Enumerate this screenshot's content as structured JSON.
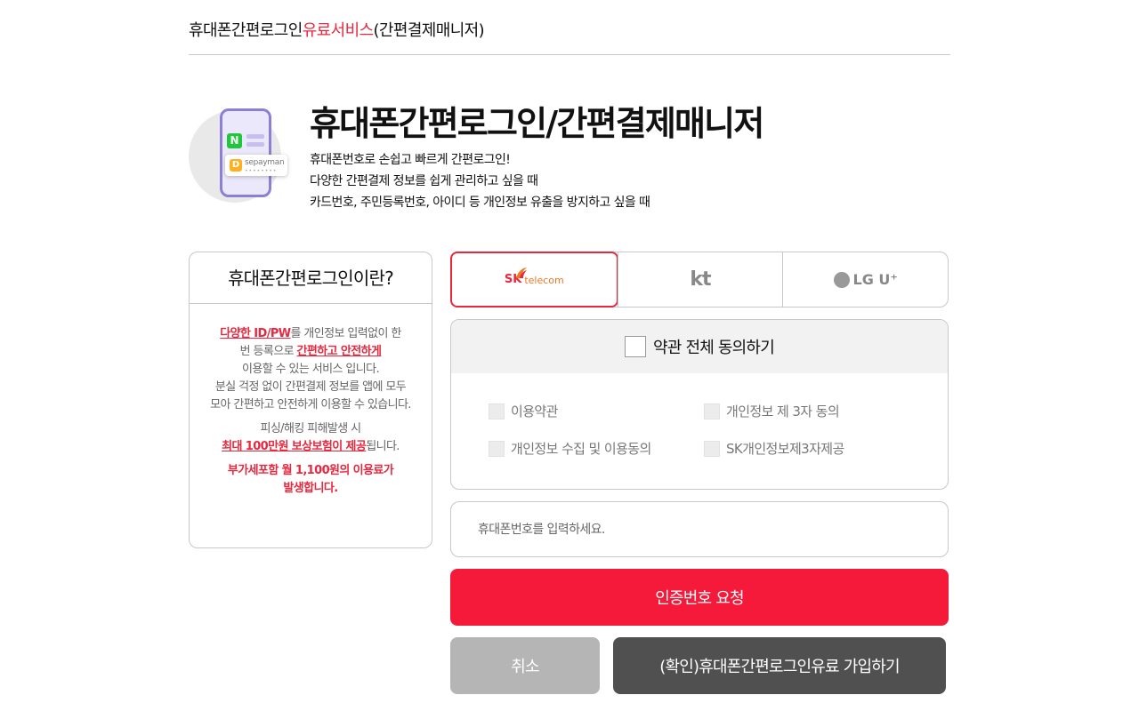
{
  "breadcrumb": {
    "prefix": "휴대폰간편로그인",
    "accent": "유료서비스",
    "suffix": "(간편결제매니저)"
  },
  "hero": {
    "title": "휴대폰간편로그인/간편결제매니저",
    "lines": [
      "휴대폰번호로 손쉽고 빠르게 간편로그인!",
      "다양한 간편결제 정보를 쉽게 관리하고 싶을 때",
      "카드번호, 주민등록번호, 아이디 등 개인정보 유출을 방지하고 싶을 때"
    ],
    "illustration": {
      "n_badge": "N",
      "d_badge": "D",
      "chip_text": "sepayman",
      "chip_dots": "••••••••"
    }
  },
  "info": {
    "title": "휴대폰간편로그인이란?",
    "p1_red": "다양한 ID/PW",
    "p1_a": "를 개인정보 입력없이 한",
    "p1_b": "번 등록으로 ",
    "p1_red2": "간편하고 안전하게",
    "p1_c": "이용할 수 있는 서비스 입니다.",
    "p2_a": "분실 걱정 없이 간편결제 정보를 앱에 모두",
    "p2_b": "모아 간편하고 안전하게 이용할 수 있습니다.",
    "p3_a": "피싱/해킹 피해발생 시",
    "p3_red": "최대 100만원 보상보험이 제공",
    "p3_b": "됩니다.",
    "fee_line1": "부가세포함 월 1,100원의 이용료가",
    "fee_line2": "발생합니다."
  },
  "carriers": {
    "selected": "SK telecom",
    "skt": {
      "sk": "SK",
      "telecom": "telecom"
    },
    "kt": "kt",
    "lgu": "LG U⁺"
  },
  "terms": {
    "all_label": "약관 전체 동의하기",
    "items": [
      "이용약관",
      "개인정보 제 3자 동의",
      "개인정보 수집 및 이용동의",
      "SK개인정보제3자제공"
    ]
  },
  "phone": {
    "placeholder": "휴대폰번호를 입력하세요.",
    "value": ""
  },
  "buttons": {
    "request": "인증번호 요청",
    "cancel": "취소",
    "confirm": "(확인)휴대폰간편로그인유료 가입하기"
  },
  "colors": {
    "accent_red": "#e8283e",
    "request_button": "#f5193a",
    "cancel_button": "#b5b5b5",
    "confirm_button": "#505050"
  }
}
